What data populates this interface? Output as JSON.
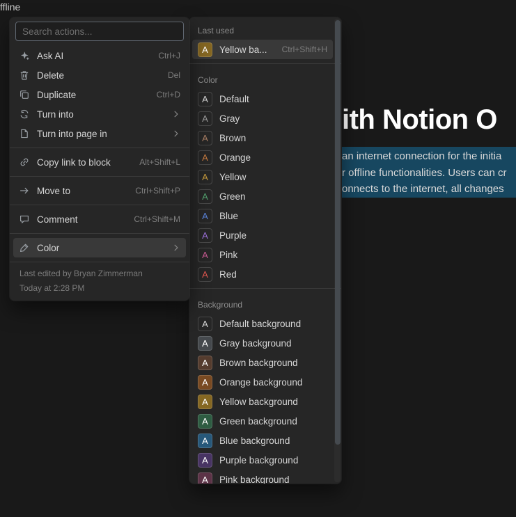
{
  "page": {
    "breadcrumb_fragment": "ffline",
    "heading_fragment": "ith Notion O",
    "highlight": {
      "color": "#174760",
      "lines": [
        "an internet connection for the initia",
        "r offline functionalities. Users can cr",
        "onnects to the internet, all changes"
      ]
    }
  },
  "context_menu": {
    "search_placeholder": "Search actions...",
    "items": [
      {
        "label": "Ask AI",
        "shortcut": "Ctrl+J",
        "icon": "sparkle-icon"
      },
      {
        "label": "Delete",
        "shortcut": "Del",
        "icon": "trash-icon"
      },
      {
        "label": "Duplicate",
        "shortcut": "Ctrl+D",
        "icon": "duplicate-icon"
      },
      {
        "label": "Turn into",
        "icon": "turn-into-icon",
        "submenu": true
      },
      {
        "label": "Turn into page in",
        "icon": "page-icon",
        "submenu": true,
        "divider_after": true
      },
      {
        "label": "Copy link to block",
        "shortcut": "Alt+Shift+L",
        "icon": "link-icon",
        "divider_after": true
      },
      {
        "label": "Move to",
        "shortcut": "Ctrl+Shift+P",
        "icon": "move-icon",
        "divider_after": true
      },
      {
        "label": "Comment",
        "shortcut": "Ctrl+Shift+M",
        "icon": "comment-icon",
        "divider_after": true
      },
      {
        "label": "Color",
        "icon": "color-icon",
        "submenu": true,
        "selected": true
      }
    ],
    "footer": {
      "edited_by": "Last edited by Bryan Zimmerman",
      "edited_at": "Today at 2:28 PM"
    }
  },
  "color_menu": {
    "chip_letter": "A",
    "sections": [
      {
        "title": "Last used",
        "items": [
          {
            "label": "Yellow ba...",
            "shortcut": "Ctrl+Shift+H",
            "chip_bg": "#856722",
            "chip_fg": "#ffffff",
            "selected": true
          }
        ]
      },
      {
        "title": "Color",
        "items": [
          {
            "label": "Default",
            "chip_fg": "#d6d6d6"
          },
          {
            "label": "Gray",
            "chip_fg": "#9b9b9b"
          },
          {
            "label": "Brown",
            "chip_fg": "#a87e64"
          },
          {
            "label": "Orange",
            "chip_fg": "#c67a3f"
          },
          {
            "label": "Yellow",
            "chip_fg": "#c69a3c"
          },
          {
            "label": "Green",
            "chip_fg": "#52a06d"
          },
          {
            "label": "Blue",
            "chip_fg": "#5a82d8"
          },
          {
            "label": "Purple",
            "chip_fg": "#9a6ed6"
          },
          {
            "label": "Pink",
            "chip_fg": "#c75a92"
          },
          {
            "label": "Red",
            "chip_fg": "#df5650"
          }
        ]
      },
      {
        "title": "Background",
        "items": [
          {
            "label": "Default background",
            "chip_fg": "#d6d6d6"
          },
          {
            "label": "Gray background",
            "chip_fg": "#ffffff",
            "chip_bg": "#45494d"
          },
          {
            "label": "Brown background",
            "chip_fg": "#ffffff",
            "chip_bg": "#553c2e"
          },
          {
            "label": "Orange background",
            "chip_fg": "#ffffff",
            "chip_bg": "#794a22"
          },
          {
            "label": "Yellow background",
            "chip_fg": "#ffffff",
            "chip_bg": "#856722"
          },
          {
            "label": "Green background",
            "chip_fg": "#ffffff",
            "chip_bg": "#2e5c42"
          },
          {
            "label": "Blue background",
            "chip_fg": "#ffffff",
            "chip_bg": "#27587a"
          },
          {
            "label": "Purple background",
            "chip_fg": "#ffffff",
            "chip_bg": "#483463"
          },
          {
            "label": "Pink background",
            "chip_fg": "#ffffff",
            "chip_bg": "#5c3347"
          }
        ]
      }
    ]
  }
}
